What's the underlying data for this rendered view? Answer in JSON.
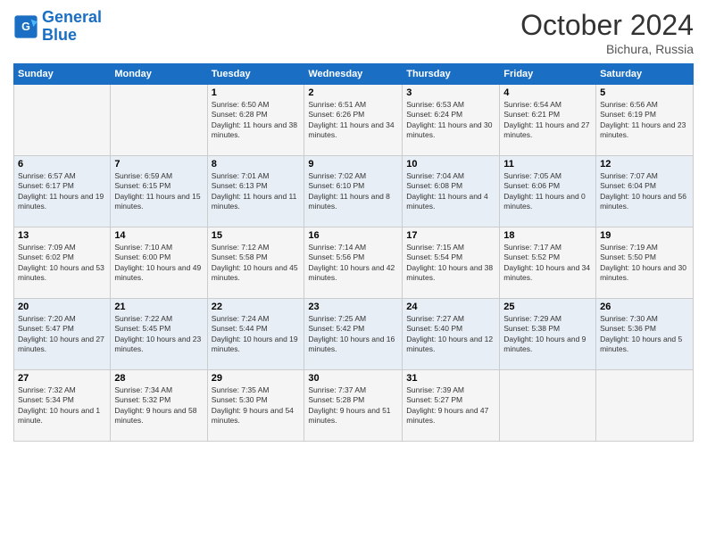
{
  "header": {
    "logo_line1": "General",
    "logo_line2": "Blue",
    "month": "October 2024",
    "location": "Bichura, Russia"
  },
  "weekdays": [
    "Sunday",
    "Monday",
    "Tuesday",
    "Wednesday",
    "Thursday",
    "Friday",
    "Saturday"
  ],
  "weeks": [
    [
      {
        "day": "",
        "info": ""
      },
      {
        "day": "",
        "info": ""
      },
      {
        "day": "1",
        "info": "Sunrise: 6:50 AM\nSunset: 6:28 PM\nDaylight: 11 hours and 38 minutes."
      },
      {
        "day": "2",
        "info": "Sunrise: 6:51 AM\nSunset: 6:26 PM\nDaylight: 11 hours and 34 minutes."
      },
      {
        "day": "3",
        "info": "Sunrise: 6:53 AM\nSunset: 6:24 PM\nDaylight: 11 hours and 30 minutes."
      },
      {
        "day": "4",
        "info": "Sunrise: 6:54 AM\nSunset: 6:21 PM\nDaylight: 11 hours and 27 minutes."
      },
      {
        "day": "5",
        "info": "Sunrise: 6:56 AM\nSunset: 6:19 PM\nDaylight: 11 hours and 23 minutes."
      }
    ],
    [
      {
        "day": "6",
        "info": "Sunrise: 6:57 AM\nSunset: 6:17 PM\nDaylight: 11 hours and 19 minutes."
      },
      {
        "day": "7",
        "info": "Sunrise: 6:59 AM\nSunset: 6:15 PM\nDaylight: 11 hours and 15 minutes."
      },
      {
        "day": "8",
        "info": "Sunrise: 7:01 AM\nSunset: 6:13 PM\nDaylight: 11 hours and 11 minutes."
      },
      {
        "day": "9",
        "info": "Sunrise: 7:02 AM\nSunset: 6:10 PM\nDaylight: 11 hours and 8 minutes."
      },
      {
        "day": "10",
        "info": "Sunrise: 7:04 AM\nSunset: 6:08 PM\nDaylight: 11 hours and 4 minutes."
      },
      {
        "day": "11",
        "info": "Sunrise: 7:05 AM\nSunset: 6:06 PM\nDaylight: 11 hours and 0 minutes."
      },
      {
        "day": "12",
        "info": "Sunrise: 7:07 AM\nSunset: 6:04 PM\nDaylight: 10 hours and 56 minutes."
      }
    ],
    [
      {
        "day": "13",
        "info": "Sunrise: 7:09 AM\nSunset: 6:02 PM\nDaylight: 10 hours and 53 minutes."
      },
      {
        "day": "14",
        "info": "Sunrise: 7:10 AM\nSunset: 6:00 PM\nDaylight: 10 hours and 49 minutes."
      },
      {
        "day": "15",
        "info": "Sunrise: 7:12 AM\nSunset: 5:58 PM\nDaylight: 10 hours and 45 minutes."
      },
      {
        "day": "16",
        "info": "Sunrise: 7:14 AM\nSunset: 5:56 PM\nDaylight: 10 hours and 42 minutes."
      },
      {
        "day": "17",
        "info": "Sunrise: 7:15 AM\nSunset: 5:54 PM\nDaylight: 10 hours and 38 minutes."
      },
      {
        "day": "18",
        "info": "Sunrise: 7:17 AM\nSunset: 5:52 PM\nDaylight: 10 hours and 34 minutes."
      },
      {
        "day": "19",
        "info": "Sunrise: 7:19 AM\nSunset: 5:50 PM\nDaylight: 10 hours and 30 minutes."
      }
    ],
    [
      {
        "day": "20",
        "info": "Sunrise: 7:20 AM\nSunset: 5:47 PM\nDaylight: 10 hours and 27 minutes."
      },
      {
        "day": "21",
        "info": "Sunrise: 7:22 AM\nSunset: 5:45 PM\nDaylight: 10 hours and 23 minutes."
      },
      {
        "day": "22",
        "info": "Sunrise: 7:24 AM\nSunset: 5:44 PM\nDaylight: 10 hours and 19 minutes."
      },
      {
        "day": "23",
        "info": "Sunrise: 7:25 AM\nSunset: 5:42 PM\nDaylight: 10 hours and 16 minutes."
      },
      {
        "day": "24",
        "info": "Sunrise: 7:27 AM\nSunset: 5:40 PM\nDaylight: 10 hours and 12 minutes."
      },
      {
        "day": "25",
        "info": "Sunrise: 7:29 AM\nSunset: 5:38 PM\nDaylight: 10 hours and 9 minutes."
      },
      {
        "day": "26",
        "info": "Sunrise: 7:30 AM\nSunset: 5:36 PM\nDaylight: 10 hours and 5 minutes."
      }
    ],
    [
      {
        "day": "27",
        "info": "Sunrise: 7:32 AM\nSunset: 5:34 PM\nDaylight: 10 hours and 1 minute."
      },
      {
        "day": "28",
        "info": "Sunrise: 7:34 AM\nSunset: 5:32 PM\nDaylight: 9 hours and 58 minutes."
      },
      {
        "day": "29",
        "info": "Sunrise: 7:35 AM\nSunset: 5:30 PM\nDaylight: 9 hours and 54 minutes."
      },
      {
        "day": "30",
        "info": "Sunrise: 7:37 AM\nSunset: 5:28 PM\nDaylight: 9 hours and 51 minutes."
      },
      {
        "day": "31",
        "info": "Sunrise: 7:39 AM\nSunset: 5:27 PM\nDaylight: 9 hours and 47 minutes."
      },
      {
        "day": "",
        "info": ""
      },
      {
        "day": "",
        "info": ""
      }
    ]
  ]
}
